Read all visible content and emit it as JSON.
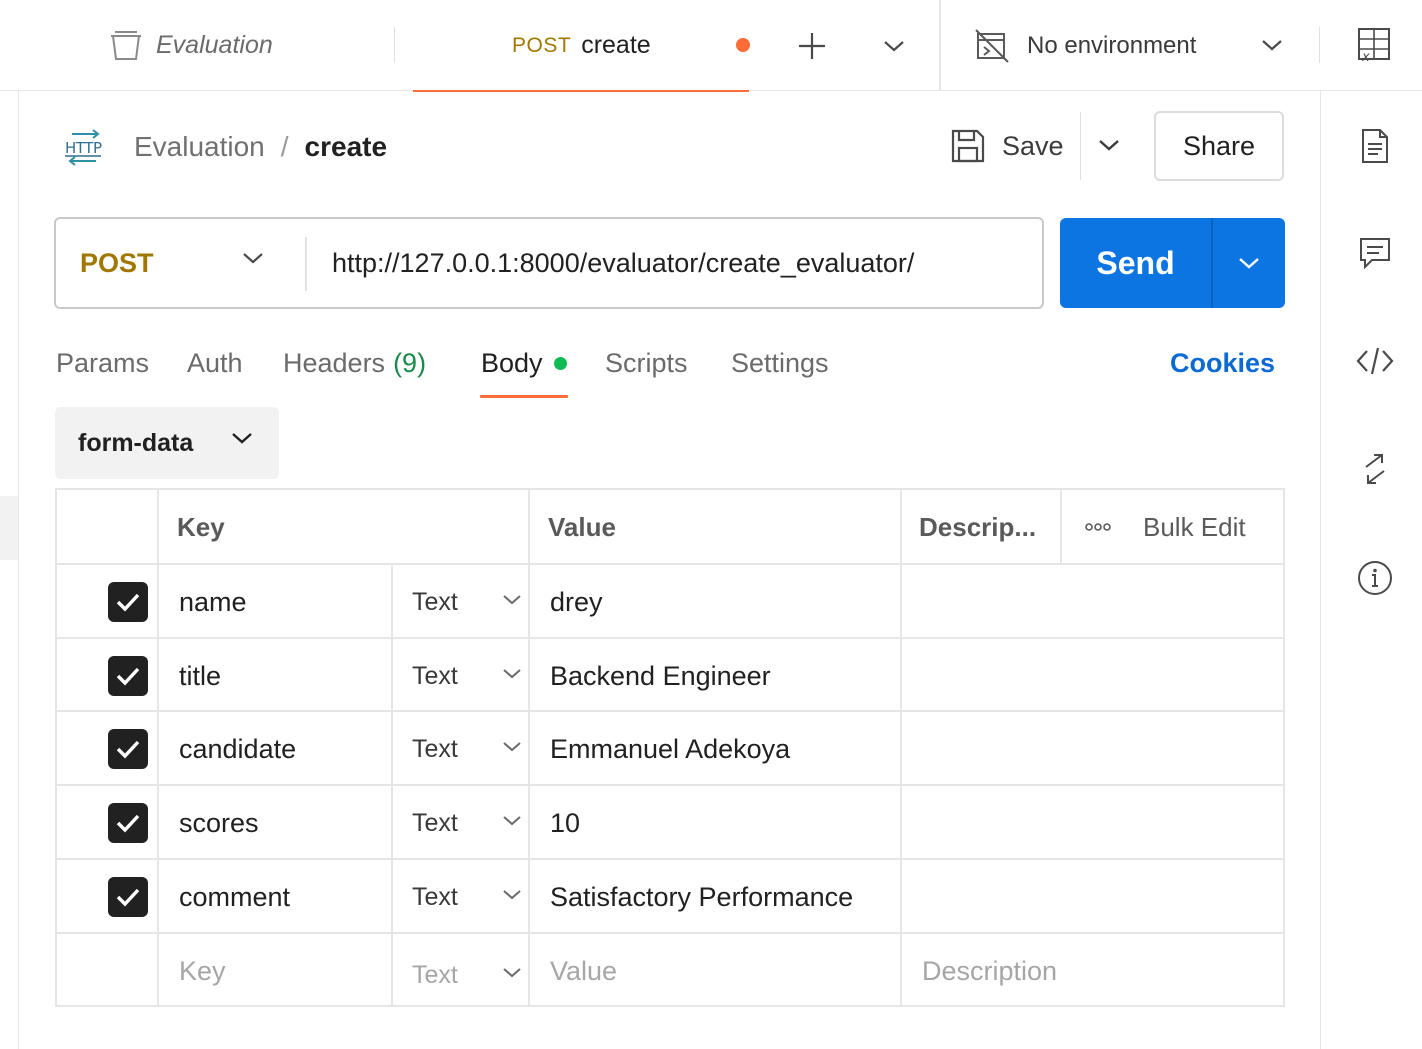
{
  "tabs": {
    "collection_tab": {
      "label": "Evaluation"
    },
    "request_tab": {
      "method": "POST",
      "name": "create"
    }
  },
  "environment": {
    "label": "No environment"
  },
  "breadcrumb": {
    "parent": "Evaluation",
    "separator": "/",
    "current": "create"
  },
  "actions": {
    "save_label": "Save",
    "share_label": "Share"
  },
  "request": {
    "method": "POST",
    "url": "http://127.0.0.1:8000/evaluator/create_evaluator/",
    "send_label": "Send"
  },
  "request_tabs": [
    {
      "label": "Params"
    },
    {
      "label": "Auth"
    },
    {
      "label": "Headers",
      "count": "(9)"
    },
    {
      "label": "Body"
    },
    {
      "label": "Scripts"
    },
    {
      "label": "Settings"
    }
  ],
  "cookies_label": "Cookies",
  "body_type": "form-data",
  "table": {
    "headers": {
      "key": "Key",
      "value": "Value",
      "description": "Descrip...",
      "bulk_edit": "Bulk Edit"
    },
    "rows": [
      {
        "key": "name",
        "type": "Text",
        "value": "drey",
        "checked": true
      },
      {
        "key": "title",
        "type": "Text",
        "value": "Backend Engineer",
        "checked": true
      },
      {
        "key": "candidate",
        "type": "Text",
        "value": "Emmanuel Adekoya",
        "checked": true
      },
      {
        "key": "scores",
        "type": "Text",
        "value": "10",
        "checked": true
      },
      {
        "key": "comment",
        "type": "Text",
        "value": "Satisfactory Performance",
        "checked": true
      }
    ],
    "placeholder_row": {
      "key": "Key",
      "type": "Text",
      "value": "Value",
      "description": "Description"
    }
  },
  "icons": {
    "collection": "collection-icon",
    "add_tab": "plus-icon",
    "tab_list": "chevron-down-icon",
    "environment": "no-environment-icon",
    "env_quick_look": "environment-quicklook-icon",
    "http": "http-icon",
    "save": "save-icon",
    "sidebar": [
      "documentation-icon",
      "comments-icon",
      "code-icon",
      "related-requests-icon",
      "info-icon"
    ]
  },
  "colors": {
    "accent": "#ff6c37",
    "send": "#0d75e2",
    "method_post": "#a07800",
    "cookies": "#0b6ad3",
    "body_dot": "#0cbb52",
    "headers_count": "#1c8a4a"
  }
}
